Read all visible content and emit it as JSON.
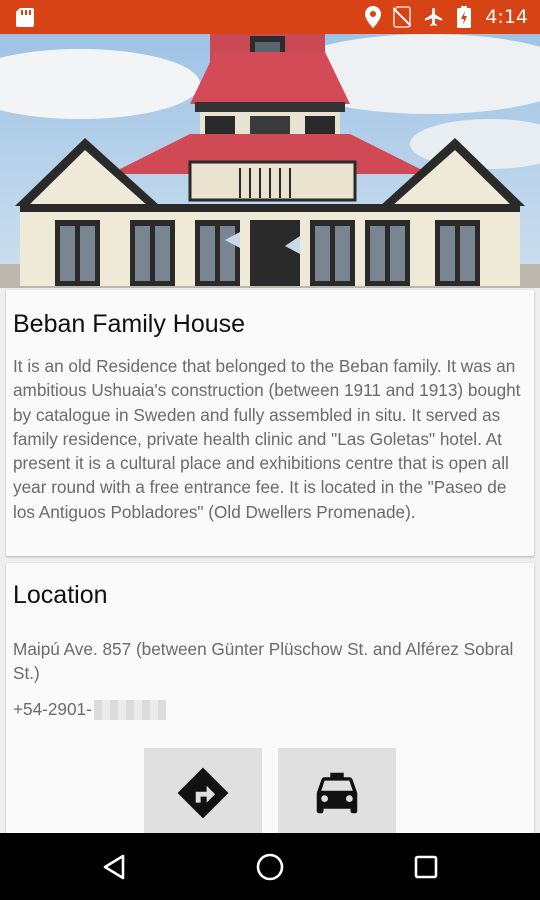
{
  "status_bar": {
    "time": "4:14",
    "icons": [
      "sd-card-icon",
      "location-icon",
      "no-sim-icon",
      "airplane-mode-icon",
      "battery-charging-icon"
    ],
    "background": "#d84315"
  },
  "hero": {
    "image": "building-photo"
  },
  "info": {
    "title": "Beban Family House",
    "description": "It is an old Residence that belonged to the Beban family. It was an ambitious Ushuaia's construction (between 1911 and 1913) bought by catalogue in Sweden and fully assembled in situ. It served as family residence, private health clinic and \"Las Goletas\" hotel. At present it is a cultural place and exhibitions centre that is open all year round with a free entrance fee. It is located in the \"Paseo de los Antiguos Pobladores\" (Old Dwellers Promenade)."
  },
  "location": {
    "title": "Location",
    "address": "Maipú Ave. 857 (between Günter Plüschow St. and Alférez Sobral St.)",
    "phone_prefix": "+54-2901-",
    "actions": [
      {
        "icon": "directions-icon"
      },
      {
        "icon": "taxi-icon"
      }
    ]
  },
  "nav_bar": {
    "buttons": [
      "back-icon",
      "home-icon",
      "recents-icon"
    ]
  }
}
